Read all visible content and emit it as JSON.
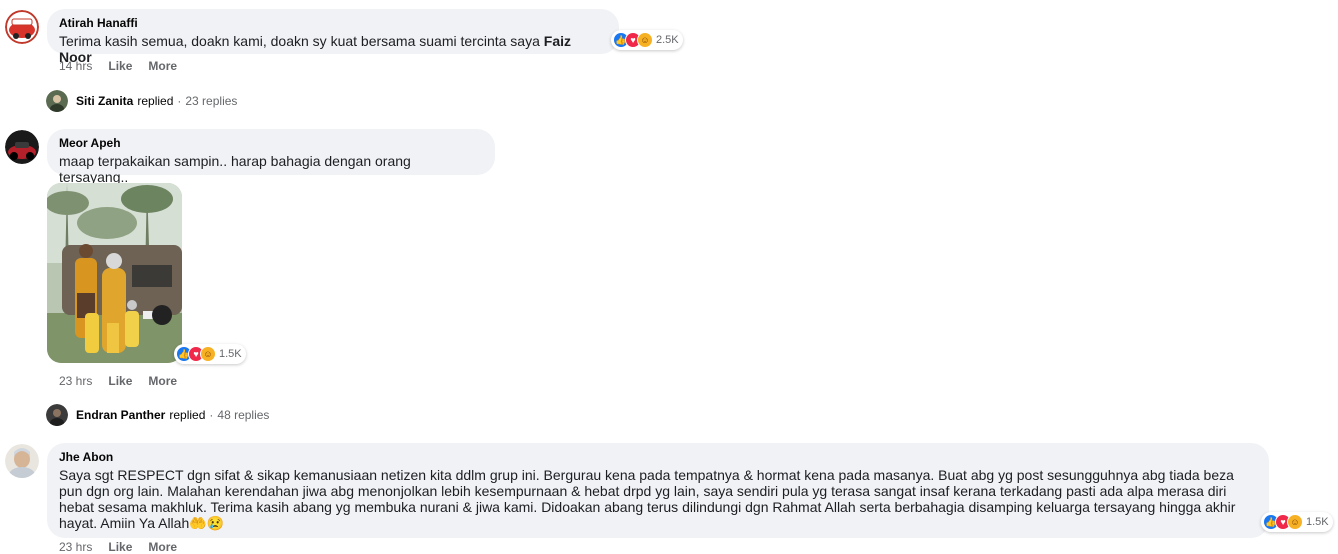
{
  "comments": [
    {
      "author": "Atirah Hanaffi",
      "text": "Terima kasih semua, doakn kami, doakn sy kuat bersama suami tercinta saya ",
      "mention": "Faiz Noor",
      "reaction_count": "2.5K",
      "time": "14 hrs",
      "like_label": "Like",
      "more_label": "More",
      "reply": {
        "name": "Siti Zanita",
        "verb": "replied",
        "sep": "·",
        "count": "23 replies"
      }
    },
    {
      "author": "Meor Apeh",
      "text": "maap terpakaikan sampin.. harap bahagia dengan orang tersayang..",
      "reaction_count": "1.5K",
      "time": "23 hrs",
      "like_label": "Like",
      "more_label": "More",
      "reply": {
        "name": "Endran Panther",
        "verb": "replied",
        "sep": "·",
        "count": "48 replies"
      }
    },
    {
      "author": "Jhe Abon",
      "text": "Saya sgt RESPECT dgn sifat & sikap kemanusiaan netizen kita ddlm grup ini. Bergurau kena pada tempatnya & hormat kena pada masanya. Buat abg yg post sesungguhnya abg tiada beza pun dgn org lain. Malahan kerendahan jiwa abg menonjolkan lebih kesempurnaan & hebat drpd yg lain, saya sendiri pula yg terasa sangat insaf kerana terkadang pasti ada alpa merasa diri hebat sesama makhluk. Terima kasih abang yg membuka nurani & jiwa kami. Didoakan abang terus dilindungi dgn Rahmat Allah serta berbahagia disamping keluarga tersayang hingga akhir hayat. Amiin Ya Allah",
      "emoji": "🤲😢",
      "reaction_count": "1.5K",
      "time": "23 hrs",
      "like_label": "Like",
      "more_label": "More"
    }
  ],
  "reaction_icons": [
    "like-icon",
    "love-icon",
    "care-icon"
  ],
  "colors": {
    "bubble": "#f0f2f5",
    "meta": "#65676b",
    "like": "#1877f2",
    "love": "#f0284a",
    "care": "#f7b125"
  }
}
